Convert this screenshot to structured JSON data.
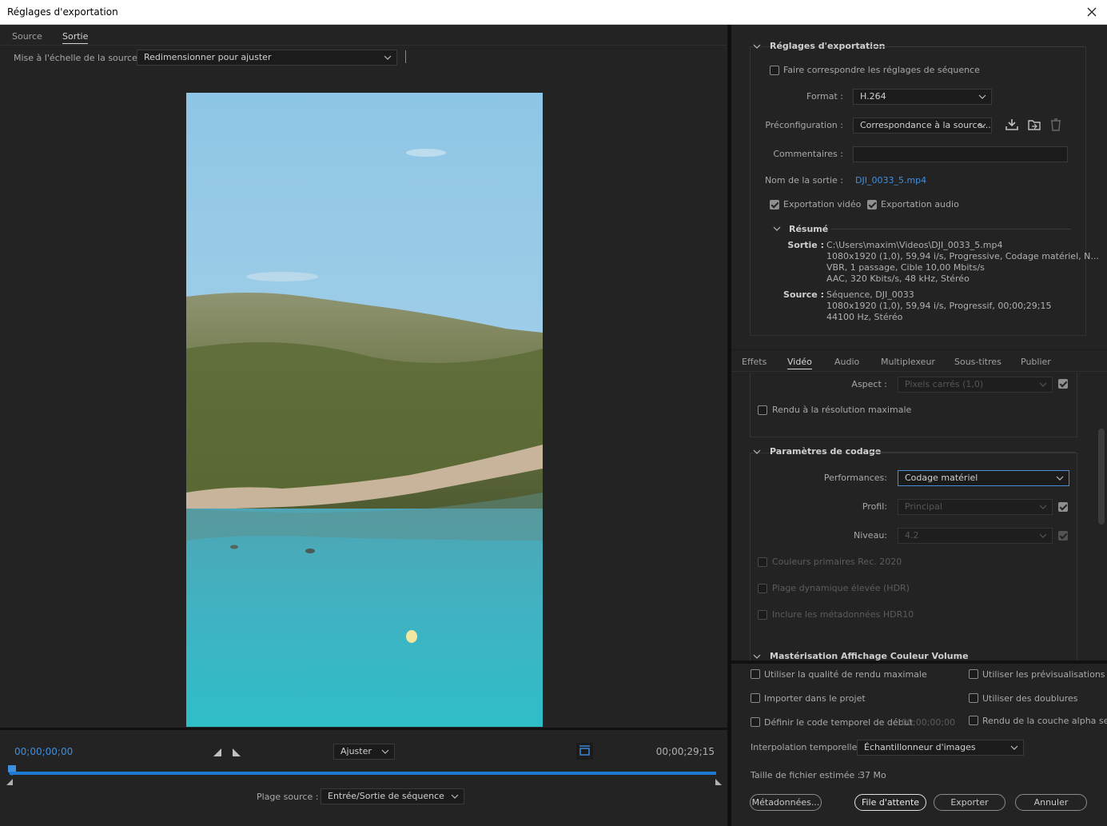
{
  "window": {
    "title": "Réglages d'exportation"
  },
  "left": {
    "tabs": [
      "Source",
      "Sortie"
    ],
    "scale_label": "Mise à l'échelle de la source :",
    "scale_value": "Redimensionner pour ajuster",
    "timecode_in": "00;00;00;00",
    "timecode_out": "00;00;29;15",
    "fit_value": "Ajuster",
    "range_label": "Plage source :",
    "range_value": "Entrée/Sortie de séquence"
  },
  "export": {
    "section_title": "Réglages d'exportation",
    "match_sequence": "Faire correspondre les réglages de séquence",
    "format_label": "Format :",
    "format_value": "H.264",
    "preset_label": "Préconfiguration :",
    "preset_value": "Correspondance à la source...",
    "comments_label": "Commentaires :",
    "output_name_label": "Nom de la sortie :",
    "output_name_value": "DJI_0033_5.mp4",
    "export_video": "Exportation vidéo",
    "export_audio": "Exportation audio",
    "summary_title": "Résumé",
    "output_label": "Sortie :",
    "output_lines": [
      "C:\\Users\\maxim\\Videos\\DJI_0033_5.mp4",
      "1080x1920 (1,0), 59,94 i/s, Progressive, Codage matériel, N...",
      "VBR, 1 passage, Cible 10,00  Mbits/s",
      "AAC, 320  Kbits/s, 48  kHz, Stéréo"
    ],
    "source_label": "Source :",
    "source_lines": [
      "Séquence, DJI_0033",
      "1080x1920 (1,0), 59,94  i/s, Progressif, 00;00;29;15",
      "44100 Hz, Stéréo"
    ]
  },
  "tabs2": [
    "Effets",
    "Vidéo",
    "Audio",
    "Multiplexeur",
    "Sous-titres",
    "Publier"
  ],
  "video": {
    "aspect_label": "Aspect :",
    "aspect_value": "Pixels carrés (1,0)",
    "max_res": "Rendu à la résolution maximale",
    "encoding_title": "Paramètres de codage",
    "performance_label": "Performances:",
    "performance_value": "Codage matériel",
    "profile_label": "Profil:",
    "profile_value": "Principal",
    "level_label": "Niveau:",
    "level_value": "4.2",
    "rec2020": "Couleurs primaires Rec. 2020",
    "hdr": "Plage dynamique élevée (HDR)",
    "hdr10": "Inclure les métadonnées HDR10",
    "mastering_title": "Mastérisation Affichage Couleur Volume"
  },
  "bottom": {
    "max_quality": "Utiliser la qualité de rendu maximale",
    "use_previews": "Utiliser les prévisualisations",
    "import_project": "Importer dans le projet",
    "use_proxies": "Utiliser des doublures",
    "set_timecode": "Définir le code temporel de début",
    "timecode_start": "00;00;00;00",
    "alpha_only": "Rendu de la couche alpha seule",
    "interp_label": "Interpolation temporelle :",
    "interp_value": "Échantillonneur d'images",
    "filesize_label": "Taille de fichier estimée :",
    "filesize_value": "37 Mo",
    "metadata_btn": "Métadonnées...",
    "queue_btn": "File d'attente",
    "export_btn": "Exporter",
    "cancel_btn": "Annuler"
  }
}
